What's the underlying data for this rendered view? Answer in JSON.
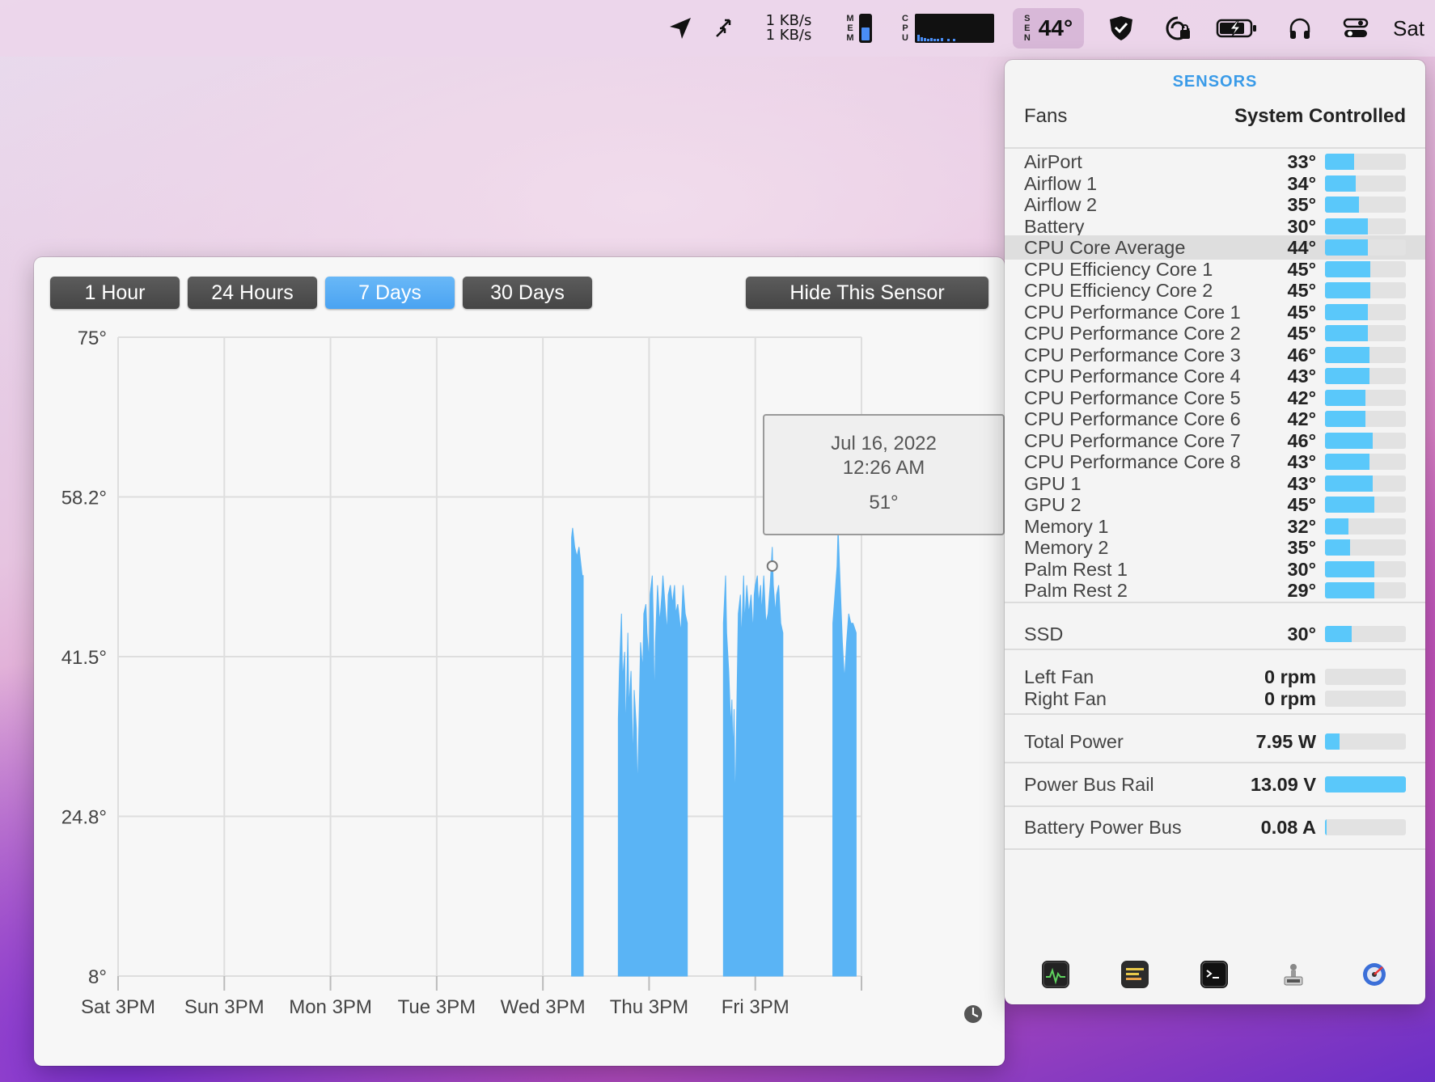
{
  "menubar": {
    "net_up": "1 KB/s",
    "net_down": "1 KB/s",
    "mem_label": [
      "M",
      "E",
      "M"
    ],
    "mem_fill": 0.55,
    "cpu_label": [
      "C",
      "P",
      "U"
    ],
    "sens_label": [
      "S",
      "E",
      "N"
    ],
    "sens_temp": "44°",
    "clock": "Sat",
    "icons": [
      "location-arrow-icon",
      "sync-arrows-icon",
      "shield-check-icon",
      "lock-sync-icon",
      "battery-charging-icon",
      "headphones-icon",
      "control-center-icon"
    ]
  },
  "graph": {
    "range_buttons": [
      "1 Hour",
      "24 Hours",
      "7 Days",
      "30 Days"
    ],
    "active_range": "7 Days",
    "hide_button": "Hide This Sensor",
    "tooltip": {
      "date": "Jul 16, 2022",
      "time": "12:26 AM",
      "value": "51°"
    }
  },
  "chart_data": {
    "type": "area",
    "title": "",
    "xlabel": "",
    "ylabel": "",
    "y_ticks": [
      "75°",
      "58.2°",
      "41.5°",
      "24.8°",
      "8°"
    ],
    "ylim": [
      8,
      75
    ],
    "x_ticks": [
      "Sat 3PM",
      "Sun 3PM",
      "Mon 3PM",
      "Tue 3PM",
      "Wed 3PM",
      "Thu 3PM",
      "Fri 3PM"
    ],
    "xlim": [
      0,
      7
    ],
    "grid": true,
    "color": "#5ab4f5",
    "segments": [
      [
        [
          4.27,
          54
        ],
        [
          4.28,
          55
        ],
        [
          4.3,
          53
        ],
        [
          4.32,
          52
        ],
        [
          4.34,
          53
        ],
        [
          4.36,
          51
        ],
        [
          4.37,
          50
        ],
        [
          4.38,
          50
        ]
      ],
      [
        [
          4.71,
          35
        ],
        [
          4.72,
          40
        ],
        [
          4.74,
          46
        ],
        [
          4.75,
          39
        ],
        [
          4.77,
          42
        ],
        [
          4.78,
          33
        ],
        [
          4.8,
          44
        ],
        [
          4.81,
          36
        ],
        [
          4.83,
          40
        ],
        [
          4.85,
          30
        ],
        [
          4.86,
          38
        ],
        [
          4.88,
          34
        ],
        [
          4.89,
          27
        ],
        [
          4.9,
          32
        ],
        [
          4.92,
          43
        ],
        [
          4.94,
          40
        ],
        [
          4.95,
          46
        ],
        [
          4.97,
          47
        ],
        [
          4.98,
          44
        ],
        [
          5.0,
          41
        ],
        [
          5.01,
          48
        ],
        [
          5.03,
          50
        ],
        [
          5.04,
          45
        ],
        [
          5.05,
          36
        ],
        [
          5.06,
          43
        ],
        [
          5.08,
          49
        ],
        [
          5.1,
          45
        ],
        [
          5.12,
          48
        ],
        [
          5.13,
          50
        ],
        [
          5.15,
          47
        ],
        [
          5.17,
          44
        ],
        [
          5.18,
          48
        ],
        [
          5.2,
          49
        ],
        [
          5.22,
          47
        ],
        [
          5.24,
          49
        ],
        [
          5.25,
          46
        ],
        [
          5.27,
          47
        ],
        [
          5.29,
          45
        ],
        [
          5.3,
          44
        ],
        [
          5.32,
          49
        ],
        [
          5.34,
          46
        ],
        [
          5.36,
          45
        ]
      ],
      [
        [
          5.7,
          45
        ],
        [
          5.72,
          50
        ],
        [
          5.73,
          44
        ],
        [
          5.75,
          40
        ],
        [
          5.77,
          34
        ],
        [
          5.78,
          37
        ],
        [
          5.79,
          31
        ],
        [
          5.8,
          36
        ],
        [
          5.81,
          25
        ],
        [
          5.82,
          32
        ],
        [
          5.84,
          46
        ],
        [
          5.86,
          48
        ],
        [
          5.87,
          43
        ],
        [
          5.89,
          50
        ],
        [
          5.9,
          45
        ],
        [
          5.92,
          49
        ],
        [
          5.94,
          46
        ],
        [
          5.96,
          48
        ],
        [
          5.98,
          44
        ],
        [
          5.99,
          48
        ],
        [
          6.0,
          49
        ],
        [
          6.02,
          50
        ],
        [
          6.03,
          47
        ],
        [
          6.05,
          49
        ],
        [
          6.06,
          46
        ],
        [
          6.08,
          50
        ],
        [
          6.1,
          45
        ],
        [
          6.12,
          46
        ],
        [
          6.14,
          49
        ],
        [
          6.16,
          53
        ],
        [
          6.17,
          49
        ],
        [
          6.19,
          46
        ],
        [
          6.2,
          48
        ],
        [
          6.22,
          49
        ],
        [
          6.24,
          45
        ],
        [
          6.26,
          44
        ]
      ],
      [
        [
          6.73,
          45
        ],
        [
          6.75,
          48
        ],
        [
          6.77,
          51
        ],
        [
          6.78,
          55
        ],
        [
          6.8,
          49
        ],
        [
          6.82,
          43
        ],
        [
          6.84,
          39
        ],
        [
          6.86,
          43
        ],
        [
          6.88,
          46
        ],
        [
          6.9,
          45
        ],
        [
          6.92,
          45
        ],
        [
          6.95,
          44
        ]
      ]
    ],
    "marker": {
      "x": 6.16,
      "y": 51
    }
  },
  "sensors": {
    "title": "SENSORS",
    "fans_label": "Fans",
    "fans_mode": "System Controlled",
    "temps": [
      {
        "name": "AirPort",
        "value": "33°",
        "fill": 0.36
      },
      {
        "name": "Airflow 1",
        "value": "34°",
        "fill": 0.38
      },
      {
        "name": "Airflow 2",
        "value": "35°",
        "fill": 0.42
      },
      {
        "name": "Battery",
        "value": "30°",
        "fill": 0.53
      },
      {
        "name": "CPU Core Average",
        "value": "44°",
        "fill": 0.53,
        "highlight": true
      },
      {
        "name": "CPU Efficiency Core 1",
        "value": "45°",
        "fill": 0.56
      },
      {
        "name": "CPU Efficiency Core 2",
        "value": "45°",
        "fill": 0.56
      },
      {
        "name": "CPU Performance Core 1",
        "value": "45°",
        "fill": 0.53
      },
      {
        "name": "CPU Performance Core 2",
        "value": "45°",
        "fill": 0.53
      },
      {
        "name": "CPU Performance Core 3",
        "value": "46°",
        "fill": 0.55
      },
      {
        "name": "CPU Performance Core 4",
        "value": "43°",
        "fill": 0.55
      },
      {
        "name": "CPU Performance Core 5",
        "value": "42°",
        "fill": 0.5
      },
      {
        "name": "CPU Performance Core 6",
        "value": "42°",
        "fill": 0.5
      },
      {
        "name": "CPU Performance Core 7",
        "value": "46°",
        "fill": 0.59
      },
      {
        "name": "CPU Performance Core 8",
        "value": "43°",
        "fill": 0.55
      },
      {
        "name": "GPU 1",
        "value": "43°",
        "fill": 0.59
      },
      {
        "name": "GPU 2",
        "value": "45°",
        "fill": 0.61
      },
      {
        "name": "Memory 1",
        "value": "32°",
        "fill": 0.29
      },
      {
        "name": "Memory 2",
        "value": "35°",
        "fill": 0.31
      },
      {
        "name": "Palm Rest 1",
        "value": "30°",
        "fill": 0.61
      },
      {
        "name": "Palm Rest 2",
        "value": "29°",
        "fill": 0.61
      }
    ],
    "ssd": {
      "name": "SSD",
      "value": "30°",
      "fill": 0.33
    },
    "fans": [
      {
        "name": "Left Fan",
        "value": "0 rpm",
        "fill": 0
      },
      {
        "name": "Right Fan",
        "value": "0 rpm",
        "fill": 0
      }
    ],
    "power": {
      "name": "Total Power",
      "value": "7.95 W",
      "fill": 0.18
    },
    "rail": {
      "name": "Power Bus Rail",
      "value": "13.09 V",
      "fill": 1.0
    },
    "battery_bus": {
      "name": "Battery Power Bus",
      "value": "0.08 A",
      "fill": 0.02
    },
    "dock_icons": [
      "activity-monitor-icon",
      "console-icon",
      "terminal-icon",
      "system-information-icon",
      "disk-utility-icon"
    ]
  }
}
